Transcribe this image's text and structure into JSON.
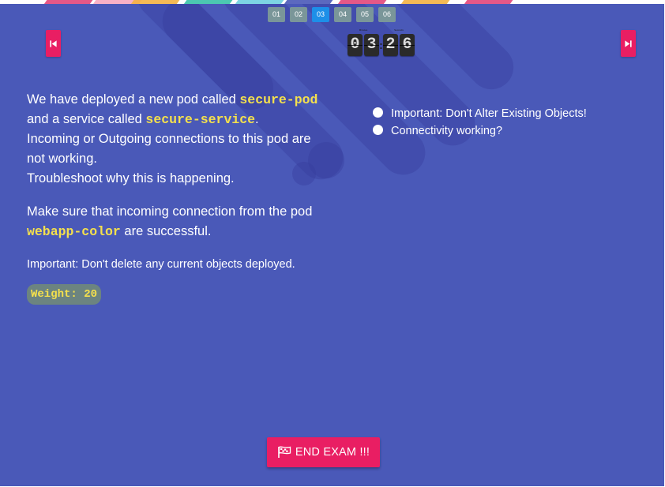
{
  "colors": {
    "background": "#4a59b8",
    "accent": "#e91e63",
    "active_question": "#1d8fe8",
    "inactive_question": "#7a9699",
    "code_highlight": "#f4e04d",
    "weight_badge": "#6c8480"
  },
  "question_nav": {
    "items": [
      {
        "label": "01",
        "active": false
      },
      {
        "label": "02",
        "active": false
      },
      {
        "label": "03",
        "active": true
      },
      {
        "label": "04",
        "active": false
      },
      {
        "label": "05",
        "active": false
      },
      {
        "label": "06",
        "active": false
      }
    ]
  },
  "nav": {
    "prev_icon": "skip-previous-icon",
    "next_icon": "skip-next-icon"
  },
  "timer": {
    "minutes_label": "Minutes",
    "seconds_label": "Seconds",
    "separator": ":",
    "minutes": [
      "0",
      "3"
    ],
    "seconds": [
      "2",
      "6"
    ]
  },
  "question": {
    "p1": {
      "t1": "We have deployed a new pod called ",
      "c1": "secure-pod",
      "t2": " and a service called ",
      "c2": "secure-service",
      "t3": ".",
      "line2": "Incoming or Outgoing connections to this pod are not working.",
      "line3": "Troubleshoot why this is happening."
    },
    "p2": {
      "t1": "Make sure that incoming connection from the pod ",
      "c1": "webapp-color",
      "t2": " are successful."
    },
    "note": "Important: Don't delete any current objects deployed.",
    "weight": "Weight: 20"
  },
  "checklist": {
    "items": [
      {
        "label": "Important: Don't Alter Existing Objects!"
      },
      {
        "label": "Connectivity working?"
      }
    ]
  },
  "end_exam": {
    "label": "END EXAM !!!",
    "icon": "flag-icon"
  }
}
